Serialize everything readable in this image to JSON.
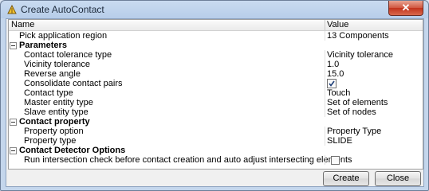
{
  "window": {
    "title": "Create AutoContact",
    "close_symbol": "✕"
  },
  "header": {
    "name": "Name",
    "value": "Value"
  },
  "rows": {
    "pick": {
      "name": "Pick application region",
      "value": "13 Components"
    },
    "parameters": {
      "label": "Parameters",
      "contact_tolerance_type": {
        "name": "Contact tolerance type",
        "value": "Vicinity tolerance"
      },
      "vicinity_tolerance": {
        "name": "Vicinity tolerance",
        "value": "1.0"
      },
      "reverse_angle": {
        "name": "Reverse angle",
        "value": "15.0"
      },
      "consolidate": {
        "name": "Consolidate contact pairs",
        "checked": true
      },
      "contact_type": {
        "name": "Contact type",
        "value": "Touch"
      },
      "master_entity_type": {
        "name": "Master entity type",
        "value": "Set of elements"
      },
      "slave_entity_type": {
        "name": "Slave entity type",
        "value": "Set of nodes"
      }
    },
    "contact_property": {
      "label": "Contact property",
      "property_option": {
        "name": "Property option",
        "value": "Property Type"
      },
      "property_type": {
        "name": "Property type",
        "value": "SLIDE"
      }
    },
    "detector": {
      "label": "Contact Detector Options",
      "intersection_check": {
        "name": "Run intersection check before contact creation and auto adjust intersecting elements",
        "checked": false
      }
    }
  },
  "buttons": {
    "create": "Create",
    "close": "Close"
  }
}
